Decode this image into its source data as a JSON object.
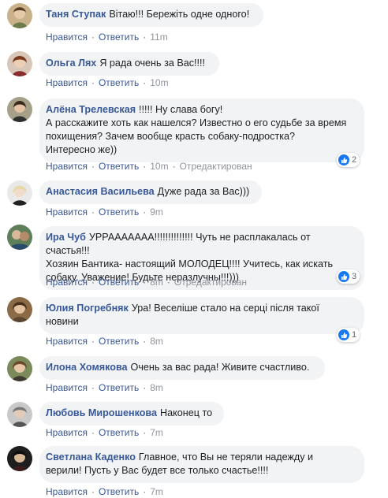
{
  "actions": {
    "like": "Нравится",
    "reply": "Ответить",
    "edited": "Отредактирован"
  },
  "comments": [
    {
      "author": "Таня Ступак",
      "text": "Вітаю!!! Бережіть одне одного!",
      "time": "11m"
    },
    {
      "author": "Ольга Лях",
      "text": "Я рада очень за Вас!!!!",
      "time": "10m"
    },
    {
      "author": "Алёна Трелевская",
      "text": "!!!!! Ну слава богу!\nА расскажите хоть как нашелся? Известно о его судьбе за время\nпохищения? Зачем вообще красть собаку-подростка?\nИнтересно же))",
      "time": "10m",
      "edited": true,
      "reactions": "2"
    },
    {
      "author": "Анастасия Васильева",
      "text": "Дуже рада за Вас)))",
      "time": "9m"
    },
    {
      "author": "Ира Чуб",
      "text": "УРРААААААА!!!!!!!!!!!!!! Чуть не расплакалась от счастья!!!\nХозяин Бантика- настоящий МОЛОДЕЦ!!!! Учитесь, как искать\nсобаку. Уважение! Будьте неразлучны!!!)))",
      "time": "8m",
      "edited": true,
      "reactions": "3"
    },
    {
      "author": "Юлия Погребняк",
      "text": "Ура! Веселіше стало на серці після такої\nновини",
      "time": "8m",
      "reactions": "1"
    },
    {
      "author": "Илона Хомякова",
      "text": "Очень за вас рада! Живите счастливо.",
      "time": "8m"
    },
    {
      "author": "Любовь Мирошенкова",
      "text": "Наконец то",
      "time": "7m"
    },
    {
      "author": "Светлана Каденко",
      "text": "Главное, что Вы не теряли надежду и\nверили! Пусть у Вас будет все только счастье!!!!",
      "time": "7m"
    }
  ]
}
